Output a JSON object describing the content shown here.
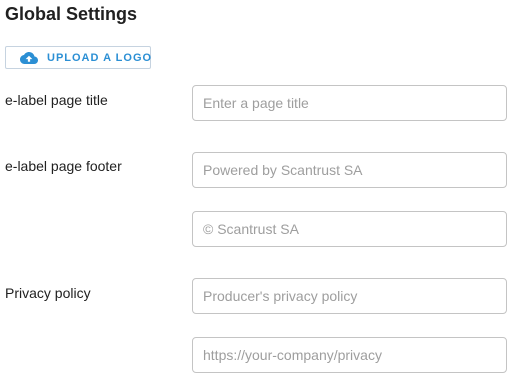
{
  "page": {
    "title": "Global Settings"
  },
  "upload": {
    "label": "UPLOAD A LOGO",
    "icon": "cloud-upload-icon",
    "accent_color": "#2b8fd4"
  },
  "fields": {
    "page_title": {
      "label": "e-label page title",
      "value": "",
      "placeholder": "Enter a page title"
    },
    "page_footer": {
      "label": "e-label page footer",
      "line1": {
        "value": "",
        "placeholder": "Powered by Scantrust SA"
      },
      "line2": {
        "value": "",
        "placeholder": "© Scantrust SA"
      }
    },
    "privacy_policy": {
      "label": "Privacy policy",
      "name": {
        "value": "",
        "placeholder": "Producer's privacy policy"
      },
      "url": {
        "value": "",
        "placeholder": "https://your-company/privacy"
      }
    }
  }
}
